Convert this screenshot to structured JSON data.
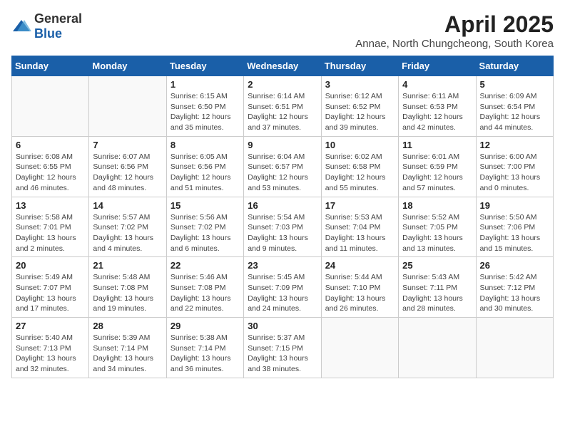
{
  "header": {
    "logo_general": "General",
    "logo_blue": "Blue",
    "title": "April 2025",
    "location": "Annae, North Chungcheong, South Korea"
  },
  "weekdays": [
    "Sunday",
    "Monday",
    "Tuesday",
    "Wednesday",
    "Thursday",
    "Friday",
    "Saturday"
  ],
  "weeks": [
    [
      {
        "day": "",
        "sunrise": "",
        "sunset": "",
        "daylight": ""
      },
      {
        "day": "",
        "sunrise": "",
        "sunset": "",
        "daylight": ""
      },
      {
        "day": "1",
        "sunrise": "Sunrise: 6:15 AM",
        "sunset": "Sunset: 6:50 PM",
        "daylight": "Daylight: 12 hours and 35 minutes."
      },
      {
        "day": "2",
        "sunrise": "Sunrise: 6:14 AM",
        "sunset": "Sunset: 6:51 PM",
        "daylight": "Daylight: 12 hours and 37 minutes."
      },
      {
        "day": "3",
        "sunrise": "Sunrise: 6:12 AM",
        "sunset": "Sunset: 6:52 PM",
        "daylight": "Daylight: 12 hours and 39 minutes."
      },
      {
        "day": "4",
        "sunrise": "Sunrise: 6:11 AM",
        "sunset": "Sunset: 6:53 PM",
        "daylight": "Daylight: 12 hours and 42 minutes."
      },
      {
        "day": "5",
        "sunrise": "Sunrise: 6:09 AM",
        "sunset": "Sunset: 6:54 PM",
        "daylight": "Daylight: 12 hours and 44 minutes."
      }
    ],
    [
      {
        "day": "6",
        "sunrise": "Sunrise: 6:08 AM",
        "sunset": "Sunset: 6:55 PM",
        "daylight": "Daylight: 12 hours and 46 minutes."
      },
      {
        "day": "7",
        "sunrise": "Sunrise: 6:07 AM",
        "sunset": "Sunset: 6:56 PM",
        "daylight": "Daylight: 12 hours and 48 minutes."
      },
      {
        "day": "8",
        "sunrise": "Sunrise: 6:05 AM",
        "sunset": "Sunset: 6:56 PM",
        "daylight": "Daylight: 12 hours and 51 minutes."
      },
      {
        "day": "9",
        "sunrise": "Sunrise: 6:04 AM",
        "sunset": "Sunset: 6:57 PM",
        "daylight": "Daylight: 12 hours and 53 minutes."
      },
      {
        "day": "10",
        "sunrise": "Sunrise: 6:02 AM",
        "sunset": "Sunset: 6:58 PM",
        "daylight": "Daylight: 12 hours and 55 minutes."
      },
      {
        "day": "11",
        "sunrise": "Sunrise: 6:01 AM",
        "sunset": "Sunset: 6:59 PM",
        "daylight": "Daylight: 12 hours and 57 minutes."
      },
      {
        "day": "12",
        "sunrise": "Sunrise: 6:00 AM",
        "sunset": "Sunset: 7:00 PM",
        "daylight": "Daylight: 13 hours and 0 minutes."
      }
    ],
    [
      {
        "day": "13",
        "sunrise": "Sunrise: 5:58 AM",
        "sunset": "Sunset: 7:01 PM",
        "daylight": "Daylight: 13 hours and 2 minutes."
      },
      {
        "day": "14",
        "sunrise": "Sunrise: 5:57 AM",
        "sunset": "Sunset: 7:02 PM",
        "daylight": "Daylight: 13 hours and 4 minutes."
      },
      {
        "day": "15",
        "sunrise": "Sunrise: 5:56 AM",
        "sunset": "Sunset: 7:02 PM",
        "daylight": "Daylight: 13 hours and 6 minutes."
      },
      {
        "day": "16",
        "sunrise": "Sunrise: 5:54 AM",
        "sunset": "Sunset: 7:03 PM",
        "daylight": "Daylight: 13 hours and 9 minutes."
      },
      {
        "day": "17",
        "sunrise": "Sunrise: 5:53 AM",
        "sunset": "Sunset: 7:04 PM",
        "daylight": "Daylight: 13 hours and 11 minutes."
      },
      {
        "day": "18",
        "sunrise": "Sunrise: 5:52 AM",
        "sunset": "Sunset: 7:05 PM",
        "daylight": "Daylight: 13 hours and 13 minutes."
      },
      {
        "day": "19",
        "sunrise": "Sunrise: 5:50 AM",
        "sunset": "Sunset: 7:06 PM",
        "daylight": "Daylight: 13 hours and 15 minutes."
      }
    ],
    [
      {
        "day": "20",
        "sunrise": "Sunrise: 5:49 AM",
        "sunset": "Sunset: 7:07 PM",
        "daylight": "Daylight: 13 hours and 17 minutes."
      },
      {
        "day": "21",
        "sunrise": "Sunrise: 5:48 AM",
        "sunset": "Sunset: 7:08 PM",
        "daylight": "Daylight: 13 hours and 19 minutes."
      },
      {
        "day": "22",
        "sunrise": "Sunrise: 5:46 AM",
        "sunset": "Sunset: 7:08 PM",
        "daylight": "Daylight: 13 hours and 22 minutes."
      },
      {
        "day": "23",
        "sunrise": "Sunrise: 5:45 AM",
        "sunset": "Sunset: 7:09 PM",
        "daylight": "Daylight: 13 hours and 24 minutes."
      },
      {
        "day": "24",
        "sunrise": "Sunrise: 5:44 AM",
        "sunset": "Sunset: 7:10 PM",
        "daylight": "Daylight: 13 hours and 26 minutes."
      },
      {
        "day": "25",
        "sunrise": "Sunrise: 5:43 AM",
        "sunset": "Sunset: 7:11 PM",
        "daylight": "Daylight: 13 hours and 28 minutes."
      },
      {
        "day": "26",
        "sunrise": "Sunrise: 5:42 AM",
        "sunset": "Sunset: 7:12 PM",
        "daylight": "Daylight: 13 hours and 30 minutes."
      }
    ],
    [
      {
        "day": "27",
        "sunrise": "Sunrise: 5:40 AM",
        "sunset": "Sunset: 7:13 PM",
        "daylight": "Daylight: 13 hours and 32 minutes."
      },
      {
        "day": "28",
        "sunrise": "Sunrise: 5:39 AM",
        "sunset": "Sunset: 7:14 PM",
        "daylight": "Daylight: 13 hours and 34 minutes."
      },
      {
        "day": "29",
        "sunrise": "Sunrise: 5:38 AM",
        "sunset": "Sunset: 7:14 PM",
        "daylight": "Daylight: 13 hours and 36 minutes."
      },
      {
        "day": "30",
        "sunrise": "Sunrise: 5:37 AM",
        "sunset": "Sunset: 7:15 PM",
        "daylight": "Daylight: 13 hours and 38 minutes."
      },
      {
        "day": "",
        "sunrise": "",
        "sunset": "",
        "daylight": ""
      },
      {
        "day": "",
        "sunrise": "",
        "sunset": "",
        "daylight": ""
      },
      {
        "day": "",
        "sunrise": "",
        "sunset": "",
        "daylight": ""
      }
    ]
  ]
}
